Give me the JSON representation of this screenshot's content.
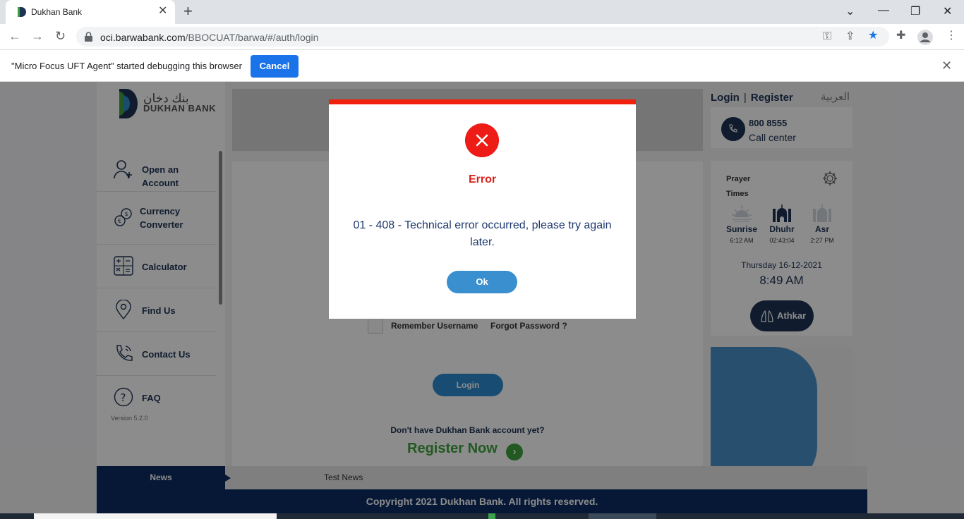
{
  "browser": {
    "tab_title": "Dukhan Bank",
    "url_host": "oci.barwabank.com",
    "url_path": "/BBOCUAT/barwa/#/auth/login",
    "infobar_text": "\"Micro Focus UFT Agent\" started debugging this browser",
    "infobar_cancel": "Cancel"
  },
  "brand": {
    "name_ar": "بنك دخان",
    "name_en": "DUKHAN BANK",
    "primary_color": "#1e3355",
    "accent_color": "#3ca23c"
  },
  "sidebar": {
    "items": [
      {
        "label": "Open an Account",
        "icon": "user-add-icon"
      },
      {
        "label": "Currency Converter",
        "icon": "currency-converter-icon"
      },
      {
        "label": "Calculator",
        "icon": "calculator-icon"
      },
      {
        "label": "Find Us",
        "icon": "location-pin-icon"
      },
      {
        "label": "Contact Us",
        "icon": "phone-icon"
      },
      {
        "label": "FAQ",
        "icon": "question-icon"
      }
    ],
    "version": "Version 5.2.0"
  },
  "login": {
    "remember_label": "Remember Username",
    "forgot_label": "Forgot Password ?",
    "login_button": "Login",
    "no_account_text": "Don't have Dukhan Bank account yet?",
    "register_now": "Register Now"
  },
  "header": {
    "login_link": "Login",
    "register_link": "Register",
    "language_link": "العربية"
  },
  "callcenter": {
    "number": "800 8555",
    "label": "Call center"
  },
  "prayer": {
    "title": "Prayer Times",
    "times": [
      {
        "name": "Sunrise",
        "time": "6:12 AM"
      },
      {
        "name": "Dhuhr",
        "time": "02:43:04"
      },
      {
        "name": "Asr",
        "time": "2:27 PM"
      }
    ],
    "date": "Thursday 16-12-2021",
    "clock": "8:49 AM",
    "athkar_label": "Athkar"
  },
  "news": {
    "tag": "News",
    "item": "Test News"
  },
  "footer": {
    "text": "Copyright 2021 Dukhan Bank. All rights reserved."
  },
  "modal": {
    "title": "Error",
    "message": "01 - 408 - Technical error occurred, please try again later.",
    "ok_label": "Ok",
    "accent_color": "#f0200c"
  }
}
